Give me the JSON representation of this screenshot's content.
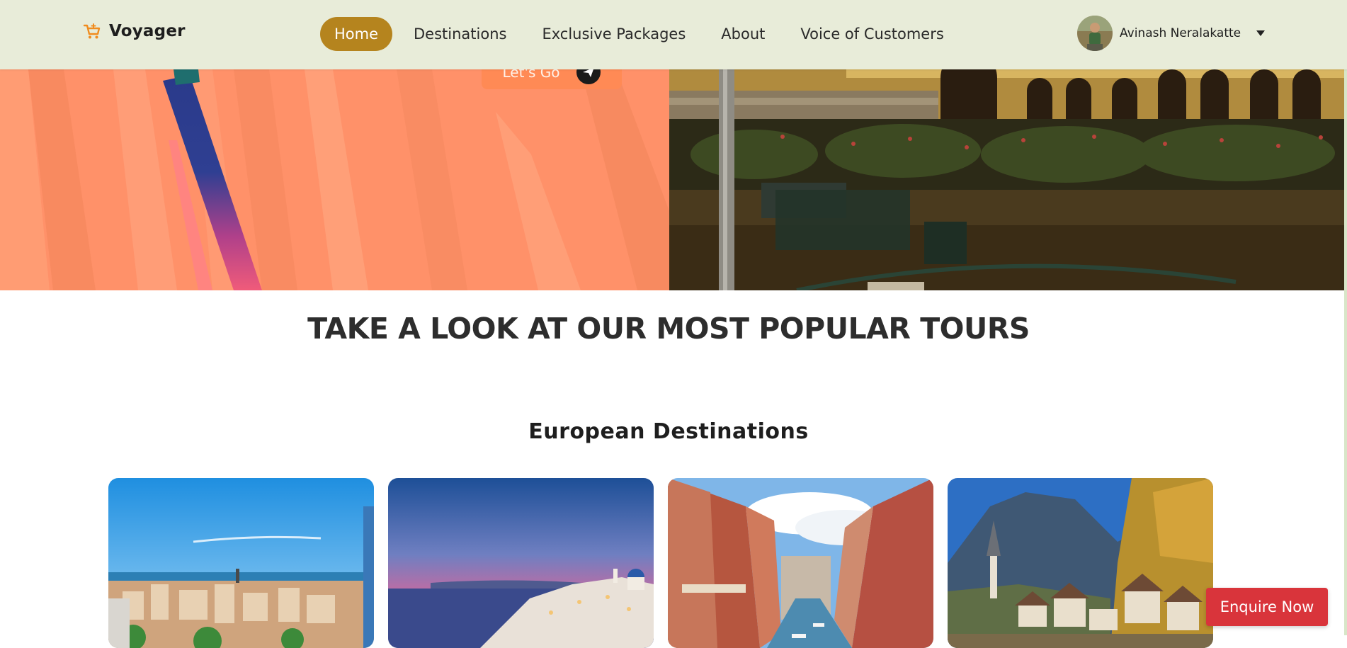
{
  "brand": {
    "name": "Voyager",
    "icon": "shopping-cart-icon",
    "accent": "#f08c1e"
  },
  "nav": {
    "items": [
      {
        "label": "Home",
        "active": true
      },
      {
        "label": "Destinations",
        "active": false
      },
      {
        "label": "Exclusive Packages",
        "active": false
      },
      {
        "label": "About",
        "active": false
      },
      {
        "label": "Voice of Customers",
        "active": false
      }
    ],
    "active_color": "#b5841e",
    "background": "#e8ecd9"
  },
  "user": {
    "name": "Avinash Neralakatte",
    "menu_icon": "caret-down-icon"
  },
  "hero": {
    "cta_label": "Let's Go",
    "cta_icon": "paper-plane-icon"
  },
  "sections": {
    "popular_title": "TAKE A LOOK AT OUR MOST POPULAR TOURS",
    "european_title": "European Destinations"
  },
  "cards": [
    {
      "image": "barcelona-cityscape"
    },
    {
      "image": "santorini-sunset"
    },
    {
      "image": "venice-canal"
    },
    {
      "image": "hallstatt-village"
    }
  ],
  "enquire": {
    "label": "Enquire Now",
    "color": "#d9343b"
  }
}
